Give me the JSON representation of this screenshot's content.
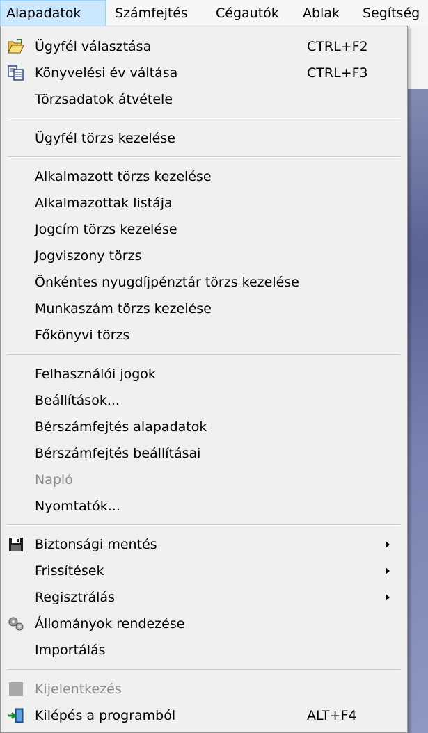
{
  "menubar": {
    "items": [
      "Alapadatok",
      "Számfejtés",
      "Cégautók",
      "Ablak",
      "Segítség"
    ]
  },
  "menu": {
    "ugyfel_valasztasa": {
      "label": "Ügyfél választása",
      "shortcut": "CTRL+F2"
    },
    "konyvelesi_ev": {
      "label": "Könyvelési év váltása",
      "shortcut": "CTRL+F3"
    },
    "torzsadatok_atvetele": {
      "label": "Törzsadatok átvétele"
    },
    "ugyfel_torzs": {
      "label": "Ügyfél törzs kezelése"
    },
    "alkalmazott_torzs": {
      "label": "Alkalmazott törzs kezelése"
    },
    "alkalmazottak_listaja": {
      "label": "Alkalmazottak listája"
    },
    "jogcim_torzs": {
      "label": "Jogcím törzs kezelése"
    },
    "jogviszony_torzs": {
      "label": "Jogviszony törzs"
    },
    "onkentes": {
      "label": "Önkéntes nyugdíjpénztár törzs kezelése"
    },
    "munkaszam": {
      "label": "Munkaszám törzs kezelése"
    },
    "fokonyvi": {
      "label": "Főkönyvi törzs"
    },
    "felhasznaloi_jogok": {
      "label": "Felhasználói jogok"
    },
    "beallitasok": {
      "label": "Beállítások..."
    },
    "berszamfejtes_alapadatok": {
      "label": "Bérszámfejtés alapadatok"
    },
    "berszamfejtes_beallitasai": {
      "label": "Bérszámfejtés beállításai"
    },
    "naplo": {
      "label": "Napló"
    },
    "nyomtatok": {
      "label": "Nyomtatók..."
    },
    "biztonsagi_mentes": {
      "label": "Biztonsági mentés"
    },
    "frissitesek": {
      "label": "Frissítések"
    },
    "regisztralas": {
      "label": "Regisztrálás"
    },
    "allomanyok": {
      "label": "Állományok rendezése"
    },
    "importalas": {
      "label": "Importálás"
    },
    "kijelentkezes": {
      "label": "Kijelentkezés"
    },
    "kilepes": {
      "label": "Kilépés a programból",
      "shortcut": "ALT+F4"
    }
  },
  "icons": {
    "ugyfel_valasztasa": "folder-open-icon",
    "konyvelesi_ev": "copy-documents-icon",
    "biztonsagi_mentes": "floppy-disk-icon",
    "allomanyok": "gears-icon",
    "kijelentkezes": "logout-box-icon",
    "kilepes": "exit-door-icon"
  },
  "colors": {
    "menu_bg": "#f0f0f0",
    "active_menu_bg": "#cce8ff",
    "disabled_text": "#8d8d8d"
  }
}
